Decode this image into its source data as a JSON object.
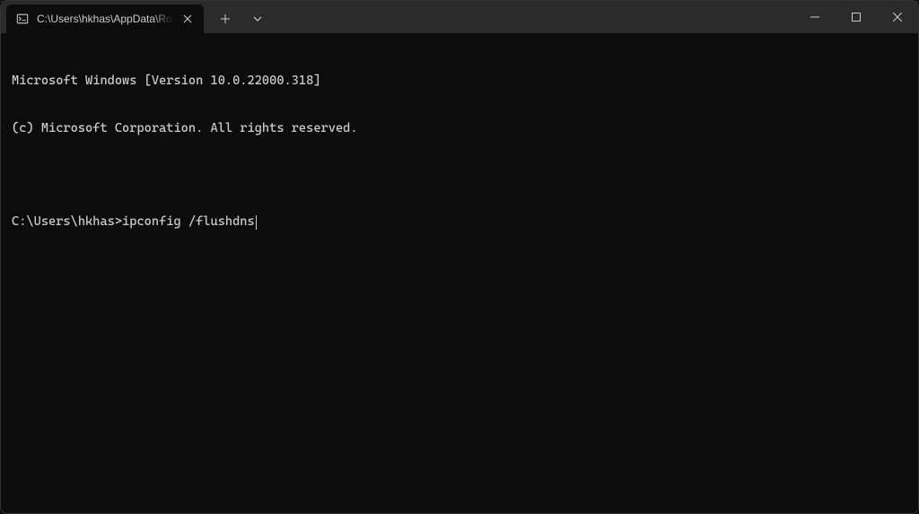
{
  "titlebar": {
    "tab": {
      "title": "C:\\Users\\hkhas\\AppData\\Roami"
    }
  },
  "terminal": {
    "line1": "Microsoft Windows [Version 10.0.22000.318]",
    "line2": "(c) Microsoft Corporation. All rights reserved.",
    "prompt": "C:\\Users\\hkhas>",
    "command": "ipconfig /flushdns"
  }
}
